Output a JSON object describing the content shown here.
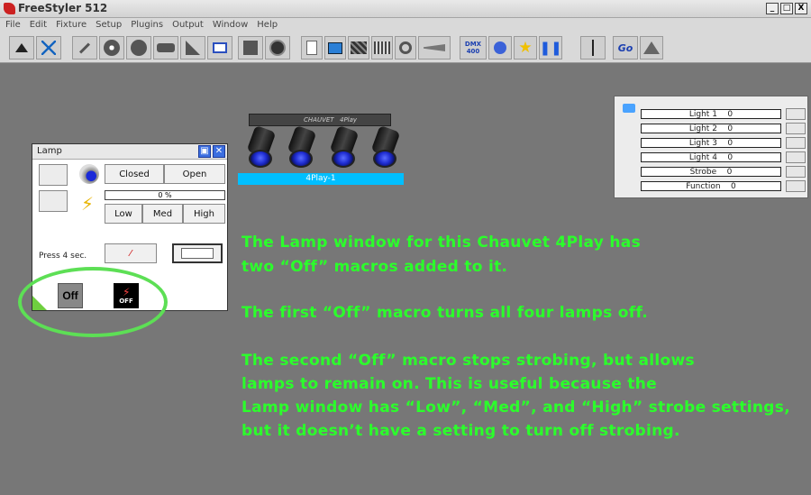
{
  "window": {
    "title": "FreeStyler 512",
    "min": "_",
    "max": "□",
    "close": "X"
  },
  "menu": [
    "File",
    "Edit",
    "Fixture",
    "Setup",
    "Plugins",
    "Output",
    "Window",
    "Help"
  ],
  "toolbar": {
    "dmx_label_1": "DMX",
    "dmx_label_2": "400",
    "go_label": "Go"
  },
  "fixture": {
    "brand": "CHAUVET",
    "model": "4Play",
    "label": "4Play-1"
  },
  "light_panel": {
    "rows": [
      {
        "name": "Light 1",
        "value": "0"
      },
      {
        "name": "Light 2",
        "value": "0"
      },
      {
        "name": "Light 3",
        "value": "0"
      },
      {
        "name": "Light 4",
        "value": "0"
      },
      {
        "name": "Strobe",
        "value": "0"
      },
      {
        "name": "Function",
        "value": "0"
      }
    ]
  },
  "lamp_window": {
    "title": "Lamp",
    "closed": "Closed",
    "open": "Open",
    "percent": "0 %",
    "low": "Low",
    "med": "Med",
    "high": "High",
    "press": "Press 4 sec.",
    "off_macro_1": "Off",
    "off_macro_2": "OFF"
  },
  "annotations": {
    "p1_l1": "The Lamp window for this Chauvet 4Play has",
    "p1_l2": "two “Off” macros added to it.",
    "p2_l1": "The first “Off” macro turns all four lamps off.",
    "p3_l1": "The second “Off” macro stops strobing, but allows",
    "p3_l2": "lamps to remain on. This is useful because the",
    "p3_l3": "Lamp window has “Low”, “Med”, and “High” strobe settings,",
    "p3_l4": "but it doesn’t have a setting to turn off strobing."
  },
  "colors": {
    "background": "#777777",
    "annotation": "#2bff2b",
    "fixture_label": "#00bfff"
  }
}
